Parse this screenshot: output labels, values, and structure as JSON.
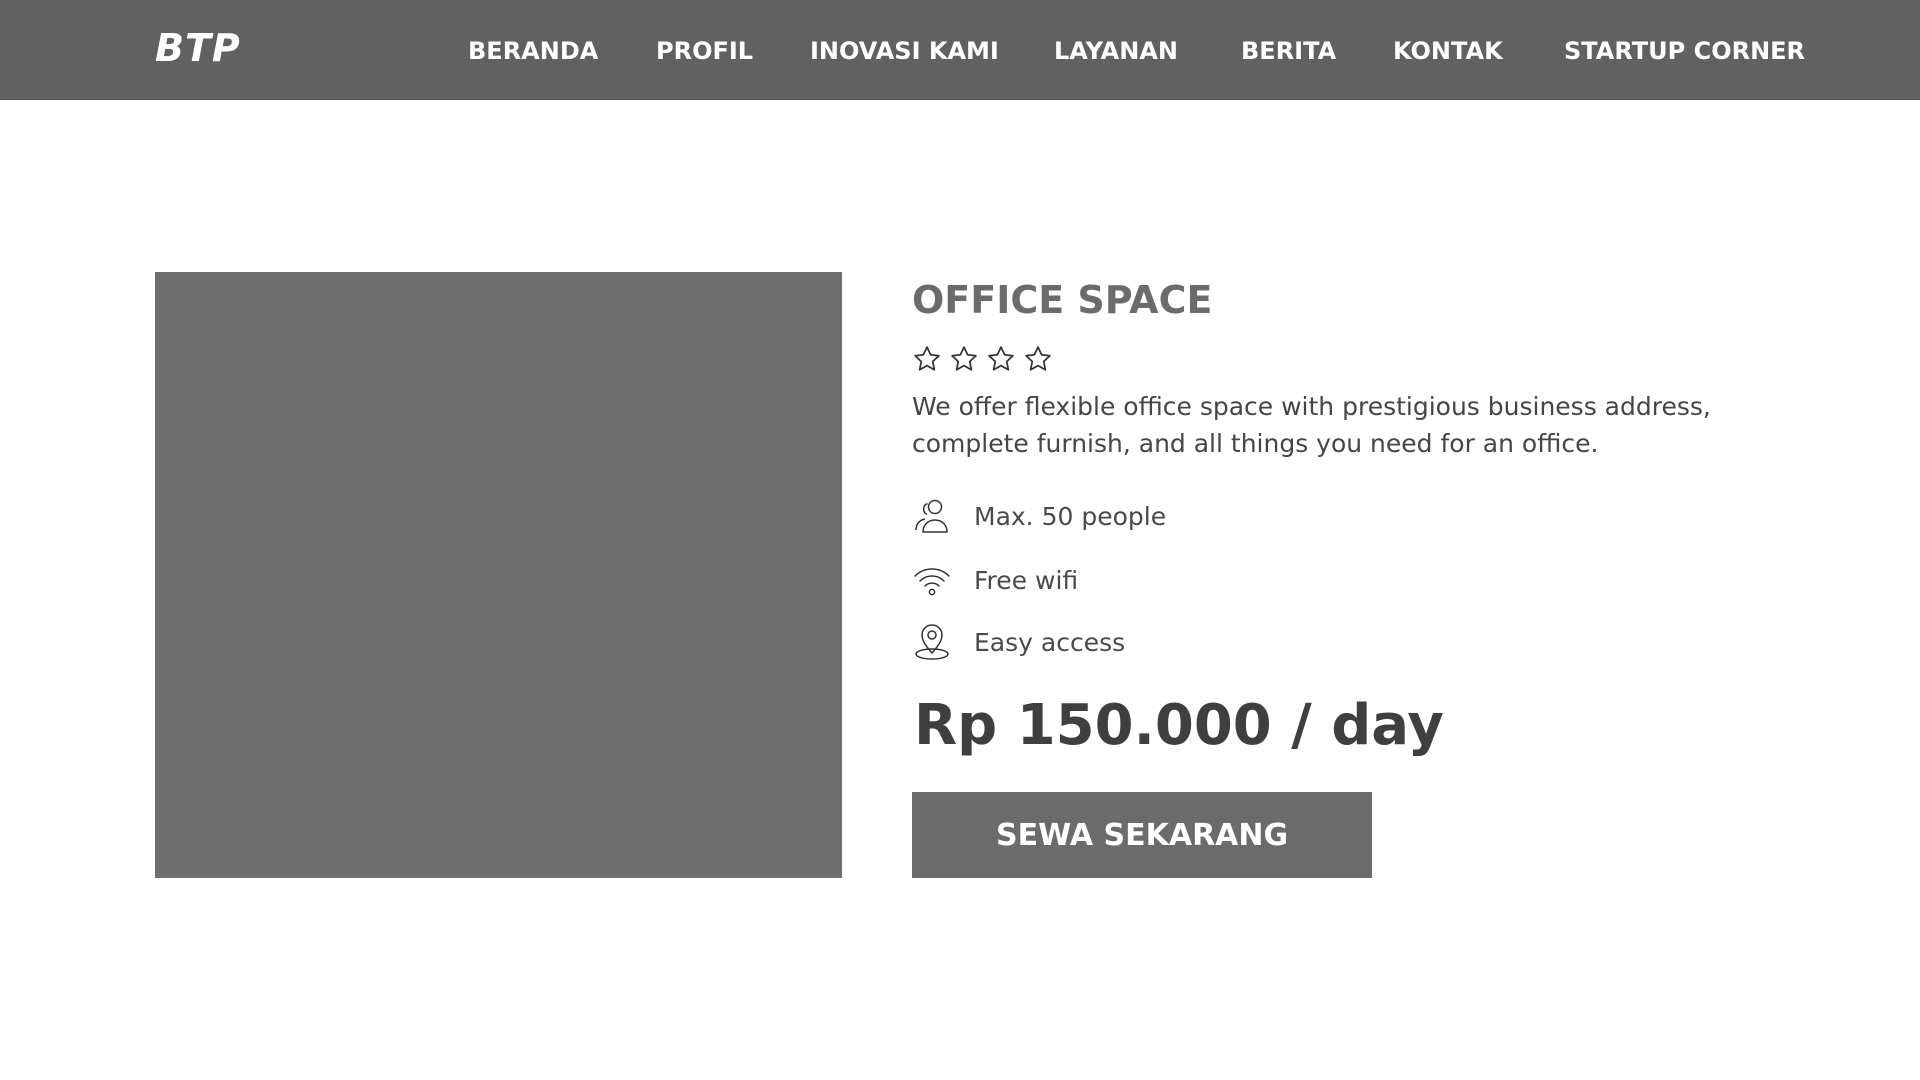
{
  "navbar": {
    "brand": "BTP",
    "links": [
      "BERANDA",
      "PROFIL",
      "INOVASI KAMI",
      "LAYANAN",
      "BERITA",
      "KONTAK",
      "STARTUP CORNER"
    ]
  },
  "product": {
    "title": "OFFICE SPACE",
    "rating": {
      "filled": 0,
      "total": 4
    },
    "description": "We offer flexible office space with prestigious business address, complete furnish, and all things you need for an office.",
    "features": [
      {
        "icon": "people-icon",
        "label": "Max. 50 people"
      },
      {
        "icon": "wifi-icon",
        "label": "Free wifi"
      },
      {
        "icon": "location-pin-icon",
        "label": "Easy access"
      }
    ],
    "price": "Rp 150.000 / day",
    "cta_label": "SEWA SEKARANG"
  },
  "colors": {
    "navbar_bg": "#616161",
    "image_placeholder": "#6f6f6f",
    "button_bg": "#6b6b6b",
    "text_dark": "#3f3f3f"
  }
}
